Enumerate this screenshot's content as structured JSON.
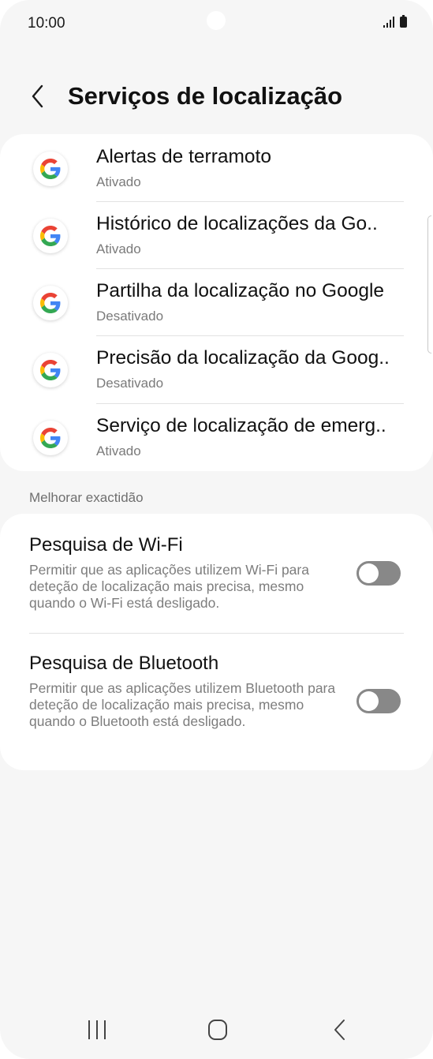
{
  "status_bar": {
    "time": "10:00"
  },
  "header": {
    "title": "Serviços de localização"
  },
  "location_apps": [
    {
      "title": "Alertas de terramoto",
      "status": "Ativado",
      "icon": "google-g-icon"
    },
    {
      "title": "Histórico de localizações da Go..",
      "status": "Ativado",
      "icon": "google-g-icon"
    },
    {
      "title": "Partilha da localização no Google",
      "status": "Desativado",
      "icon": "google-g-icon"
    },
    {
      "title": "Precisão da localização da Goog..",
      "status": "Desativado",
      "icon": "google-g-icon"
    },
    {
      "title": "Serviço de localização de emerg..",
      "status": "Ativado",
      "icon": "google-g-icon"
    }
  ],
  "section": {
    "label": "Melhorar exactidão"
  },
  "scanning": [
    {
      "title": "Pesquisa de Wi-Fi",
      "description": "Permitir que as aplicações utilizem Wi-Fi para deteção de localização mais precisa, mesmo quando o Wi-Fi está desligado.",
      "enabled": false
    },
    {
      "title": "Pesquisa de Bluetooth",
      "description": "Permitir que as aplicações utilizem Bluetooth para deteção de localização mais precisa, mesmo quando o Bluetooth está desligado.",
      "enabled": false
    }
  ],
  "colors": {
    "background": "#f6f6f6",
    "card": "#ffffff",
    "toggle_off": "#888888",
    "google_blue": "#4285F4",
    "google_red": "#EA4335",
    "google_yellow": "#FBBC05",
    "google_green": "#34A853"
  }
}
